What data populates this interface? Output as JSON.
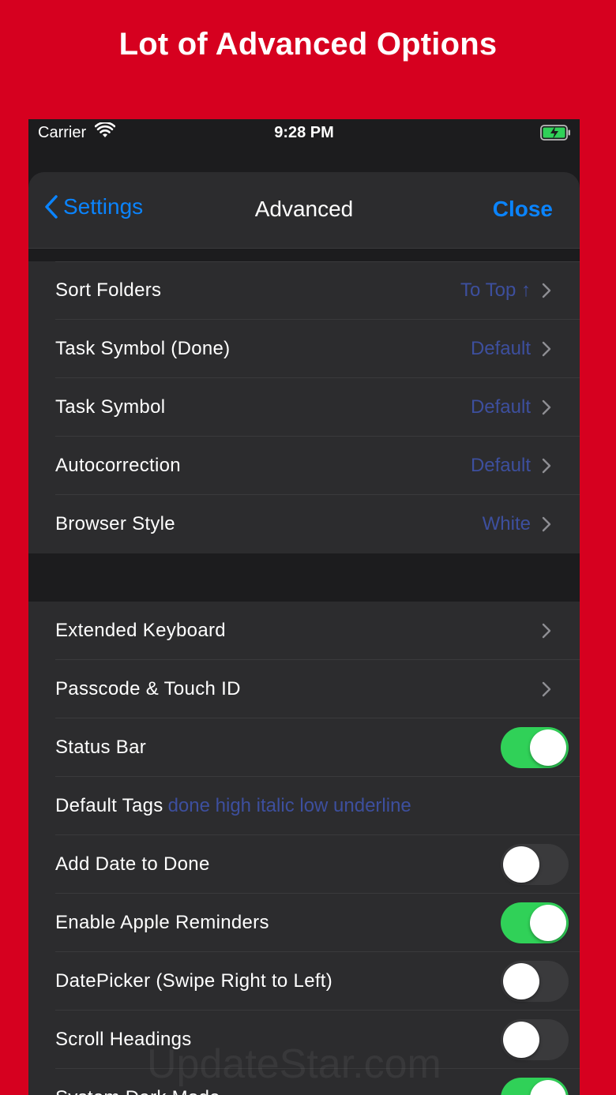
{
  "headline": "Lot of Advanced Options",
  "status_bar": {
    "carrier": "Carrier",
    "time": "9:28 PM",
    "wifi_icon": "wifi-icon",
    "battery_icon": "battery-charging-icon"
  },
  "nav": {
    "back_label": "Settings",
    "title": "Advanced",
    "close_label": "Close"
  },
  "group1": {
    "rows": [
      {
        "label": "Sort Folders",
        "value": "To Top ↑"
      },
      {
        "label": "Task Symbol (Done)",
        "value": "Default"
      },
      {
        "label": "Task Symbol",
        "value": "Default"
      },
      {
        "label": "Autocorrection",
        "value": "Default"
      },
      {
        "label": "Browser Style",
        "value": "White"
      }
    ]
  },
  "group2": {
    "extended_keyboard": "Extended Keyboard",
    "passcode": "Passcode & Touch ID",
    "status_bar": {
      "label": "Status Bar",
      "on": true
    },
    "default_tags": {
      "label": "Default Tags",
      "value": "done high italic low underline"
    },
    "add_date": {
      "label": "Add Date to Done",
      "on": false
    },
    "reminders": {
      "label": "Enable Apple Reminders",
      "on": true
    },
    "datepicker": {
      "label": "DatePicker (Swipe Right to Left)",
      "on": false
    },
    "scroll_headings": {
      "label": "Scroll Headings",
      "on": false
    },
    "system_dark": {
      "label": "System Dark Mode",
      "on": true
    }
  },
  "watermark": "UpdateStar.com",
  "colors": {
    "background": "#D6001F",
    "accent": "#0A84FF",
    "value_text": "#3D4F9E",
    "toggle_on": "#30D158",
    "cell": "#2C2C2E"
  }
}
